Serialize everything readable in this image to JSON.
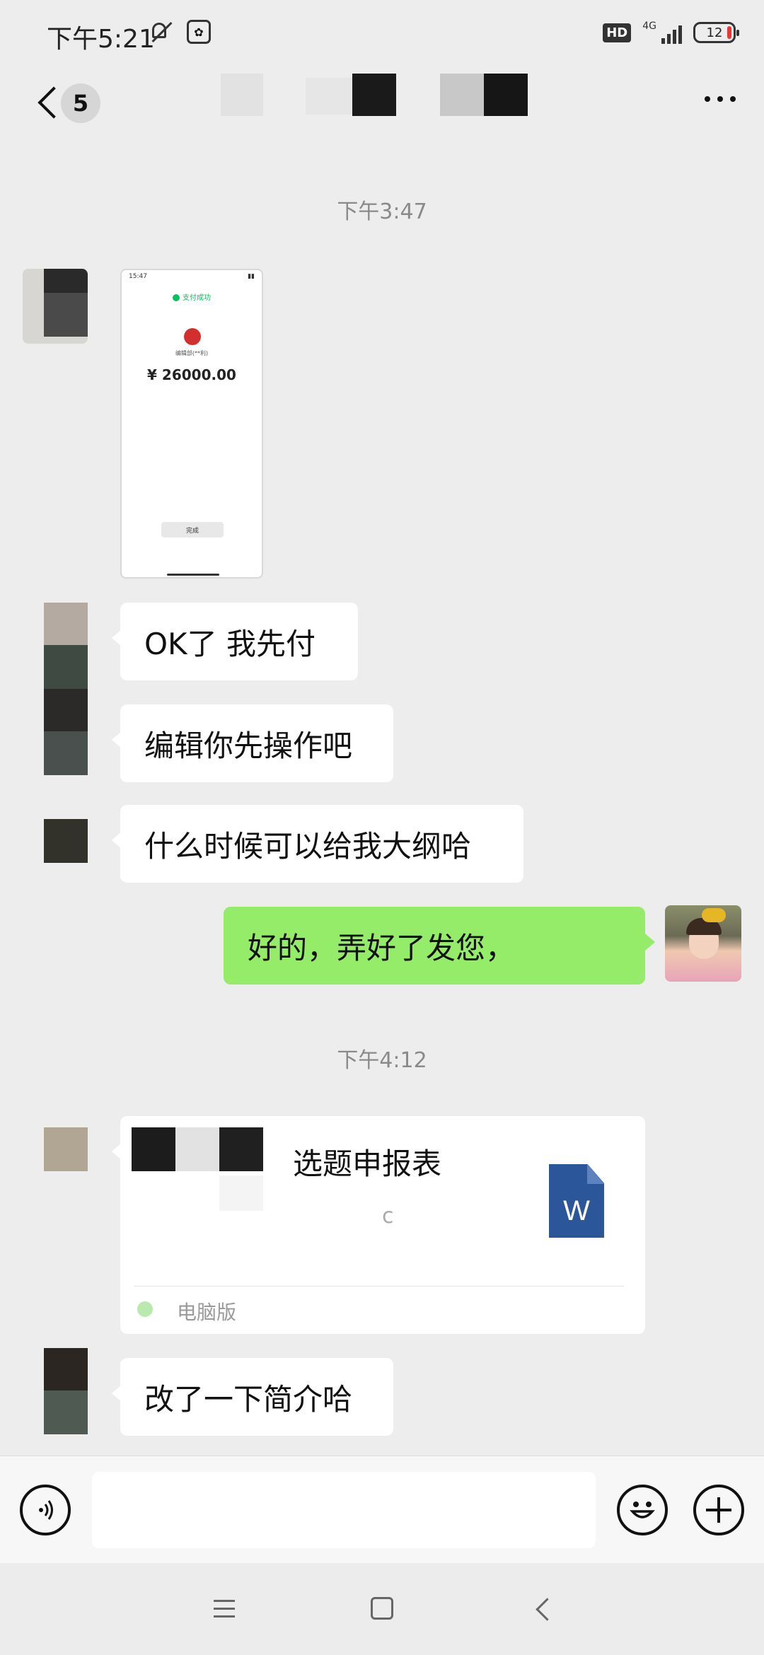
{
  "status_bar": {
    "time": "下午5:21",
    "network": "4G",
    "hd": "HD",
    "battery": "12"
  },
  "nav": {
    "unread_count": "5"
  },
  "messages": {
    "ts1": "下午3:47",
    "image": {
      "amount": "¥ 26000.00",
      "done": "完成",
      "time": "15:47"
    },
    "m1": "OK了 我先付",
    "m2": "编辑你先操作吧",
    "m3": "什么时候可以给我大纲哈",
    "m4": "好的，弄好了发您，",
    "ts2": "下午4:12",
    "file": {
      "name": "选题申报表",
      "source": "电脑版",
      "type_letter": "W"
    },
    "m5": "改了一下简介哈"
  },
  "colors": {
    "mine_bubble": "#95ec69",
    "background": "#ededed",
    "word_blue": "#2b579a"
  },
  "icons": [
    "back-icon",
    "more-icon",
    "voice-icon",
    "emoji-icon",
    "plus-icon",
    "word-file-icon"
  ]
}
